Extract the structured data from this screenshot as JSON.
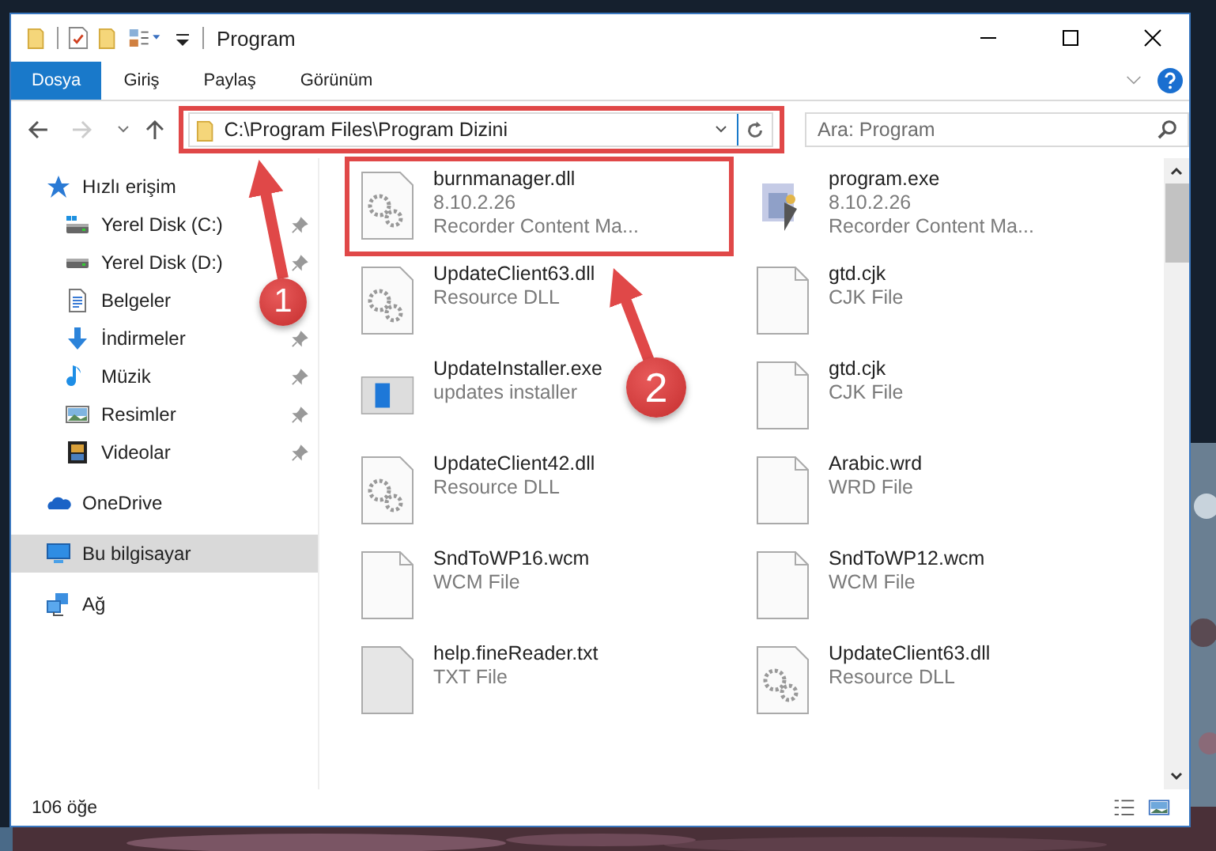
{
  "window": {
    "title": "Program"
  },
  "ribbon_tabs": [
    {
      "label": "Dosya",
      "selected": true
    },
    {
      "label": "Giriş",
      "selected": false
    },
    {
      "label": "Paylaş",
      "selected": false
    },
    {
      "label": "Görünüm",
      "selected": false
    }
  ],
  "address": {
    "path": "C:\\Program Files\\Program Dizini"
  },
  "search": {
    "placeholder": "Ara: Program"
  },
  "sidebar": {
    "items": [
      {
        "label": "Hızlı erişim",
        "kind": "star",
        "selected": false,
        "children": [
          {
            "label": "Yerel Disk (C:)",
            "kind": "drive-c",
            "pinned": true,
            "selected": false
          },
          {
            "label": "Yerel Disk (D:)",
            "kind": "drive",
            "pinned": true,
            "selected": false
          },
          {
            "label": "Belgeler",
            "kind": "docs",
            "pinned": false,
            "selected": false
          },
          {
            "label": "İndirmeler",
            "kind": "download",
            "pinned": true,
            "selected": false
          },
          {
            "label": "Müzik",
            "kind": "music",
            "pinned": true,
            "selected": false
          },
          {
            "label": "Resimler",
            "kind": "pictures",
            "pinned": true,
            "selected": false
          },
          {
            "label": "Videolar",
            "kind": "videos",
            "pinned": true,
            "selected": false
          }
        ]
      },
      {
        "label": "OneDrive",
        "kind": "cloud",
        "selected": false
      },
      {
        "label": "Bu bilgisayar",
        "kind": "pc",
        "selected": true
      },
      {
        "label": "Ağ",
        "kind": "network",
        "selected": false
      }
    ]
  },
  "files": [
    {
      "name": "burnmanager.dll",
      "details": [
        "8.10.2.26",
        "Recorder Content Ma..."
      ],
      "kind": "gears"
    },
    {
      "name": "program.exe",
      "details": [
        "8.10.2.26",
        "Recorder Content Ma..."
      ],
      "kind": "setup"
    },
    {
      "name": "UpdateClient63.dll",
      "details": [
        "Resource DLL"
      ],
      "kind": "gears"
    },
    {
      "name": "gtd.cjk",
      "details": [
        "CJK File"
      ],
      "kind": "blank"
    },
    {
      "name": "UpdateInstaller.exe",
      "details": [
        "updates installer"
      ],
      "kind": "app"
    },
    {
      "name": "gtd.cjk",
      "details": [
        "CJK File"
      ],
      "kind": "blank"
    },
    {
      "name": "UpdateClient42.dll",
      "details": [
        "Resource DLL"
      ],
      "kind": "gears"
    },
    {
      "name": "Arabic.wrd",
      "details": [
        "WRD File"
      ],
      "kind": "blank"
    },
    {
      "name": "SndToWP16.wcm",
      "details": [
        "WCM File"
      ],
      "kind": "blank"
    },
    {
      "name": "SndToWP12.wcm",
      "details": [
        "WCM File"
      ],
      "kind": "blank"
    },
    {
      "name": "help.fineReader.txt",
      "details": [
        "TXT File"
      ],
      "kind": "text"
    },
    {
      "name": "UpdateClient63.dll",
      "details": [
        "Resource DLL"
      ],
      "kind": "gears"
    }
  ],
  "annotations": [
    {
      "number": "1"
    },
    {
      "number": "2"
    }
  ],
  "status_bar": {
    "count": "106 öğe"
  }
}
